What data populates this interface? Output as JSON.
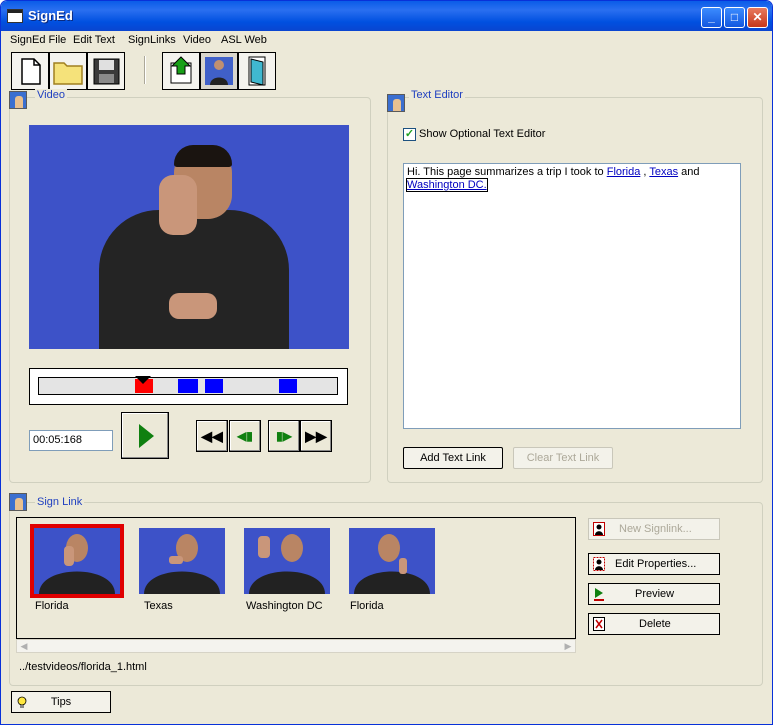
{
  "window": {
    "title": "SignEd",
    "minimize": "_",
    "maximize": "□",
    "close": "✕"
  },
  "menu": [
    "SignEd File",
    "Edit Text",
    "SignLinks",
    "Video",
    "ASL Web"
  ],
  "toolbar": {
    "icons": [
      "new-file-icon",
      "open-folder-icon",
      "save-disk-icon",
      "upload-icon",
      "signer-icon",
      "exit-door-icon"
    ]
  },
  "video_panel": {
    "label": "Video",
    "time": "00:05:168",
    "controls": {
      "rewind": "◀◀",
      "step_back": "◀▮",
      "step_forward": "▮▶",
      "fast_forward": "▶▶"
    }
  },
  "text_editor": {
    "label": "Text Editor",
    "checkbox_label": "Show Optional Text Editor",
    "checked": true,
    "content": {
      "prefix": "Hi. This page summarizes a trip I took to ",
      "link1": "Florida",
      "sep1": " , ",
      "link2": "Texas",
      "sep2": " and ",
      "link3": "Washington DC."
    },
    "add_button": "Add Text Link",
    "clear_button": "Clear Text Link"
  },
  "sign_link": {
    "label": "Sign Link",
    "thumbnails": [
      {
        "label": "Florida"
      },
      {
        "label": "Texas"
      },
      {
        "label": "Washington DC"
      },
      {
        "label": "Florida"
      }
    ],
    "path": "../testvideos/florida_1.html",
    "buttons": {
      "new": "New Signlink...",
      "edit": "Edit Properties...",
      "preview": "Preview",
      "delete": "Delete"
    }
  },
  "tips_button": "Tips",
  "colors": {
    "title_blue": "#0a5ce8",
    "video_bg": "#3d52c8",
    "marker_red": "#ff0000",
    "marker_blue": "#0000ff",
    "group_label": "#2040c0"
  }
}
